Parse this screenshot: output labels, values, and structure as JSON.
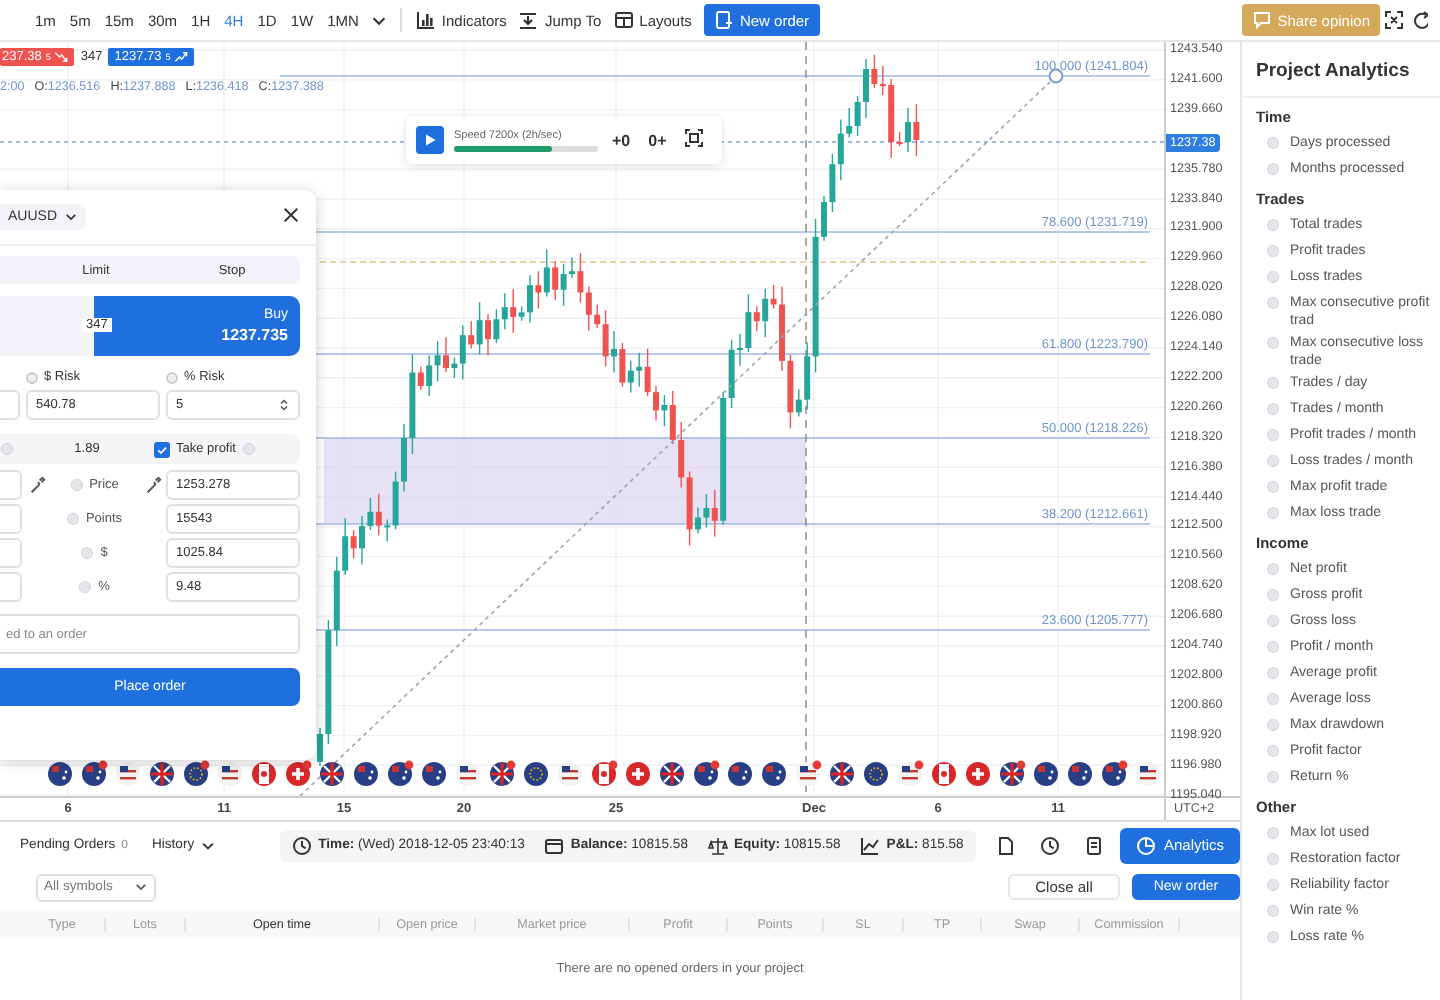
{
  "toolbar": {
    "timeframes": [
      {
        "label": "1m",
        "selected": false
      },
      {
        "label": "5m",
        "selected": false
      },
      {
        "label": "15m",
        "selected": false
      },
      {
        "label": "30m",
        "selected": false
      },
      {
        "label": "1H",
        "selected": false
      },
      {
        "label": "4H",
        "selected": true
      },
      {
        "label": "1D",
        "selected": false
      },
      {
        "label": "1W",
        "selected": false
      },
      {
        "label": "1MN",
        "selected": false
      }
    ],
    "tools": [
      {
        "label": "Indicators",
        "kind": "indicators"
      },
      {
        "label": "Jump To",
        "kind": "jump"
      },
      {
        "label": "Layouts",
        "kind": "layouts"
      },
      {
        "label": "New order",
        "kind": "primary"
      }
    ],
    "share_button": "Share opinion"
  },
  "chart": {
    "sell_price": "237.38$^{5}$",
    "spread": "347",
    "buy_price": "1237.73$^{5}$",
    "ohlc_time": "2:00",
    "ohlc": [
      {
        "label": "O:",
        "value": "1236.516"
      },
      {
        "label": "H:",
        "value": "1237.888"
      },
      {
        "label": "L:",
        "value": "1236.418"
      },
      {
        "label": "C:",
        "value": "1237.388"
      }
    ],
    "fib_levels": [
      "100.000 (1241.804)",
      "78.600 (1231.719)",
      "61.800 (1223.790)",
      "50.000 (1218.226)",
      "38.200 (1212.661)",
      "23.600 (1205.777)"
    ],
    "price_ticks": [
      "1243.540",
      "1241.600",
      "1239.660",
      "1235.780",
      "1233.840",
      "1231.900",
      "1229.960",
      "1228.020",
      "1226.080",
      "1224.140",
      "1222.200",
      "1220.260",
      "1218.320",
      "1216.380",
      "1214.440",
      "1212.500",
      "1210.560",
      "1208.620",
      "1206.680",
      "1204.740",
      "1202.800",
      "1200.860",
      "1198.920",
      "1196.980",
      "1195.040"
    ],
    "current_price": "1237.38",
    "date_ticks": [
      "6",
      "11",
      "15",
      "20",
      "25",
      "Dec",
      "6",
      "11"
    ],
    "timezone": "UTC+2"
  },
  "replay": {
    "speed_label": "Speed 7200x (2h/sec)",
    "level": 0.68,
    "step_back": "+0",
    "step_forward": "0+"
  },
  "order_panel": {
    "symbol": "AUUSD",
    "tabs": [
      {
        "label": "Limit",
        "selected": false
      },
      {
        "label": "Stop",
        "selected": false
      }
    ],
    "spread": "347",
    "buy_label": "Buy",
    "buy_price": "1237.735",
    "risk": [
      {
        "label": "$ Risk",
        "value": "540.78",
        "selected": false
      },
      {
        "label": "% Risk",
        "value": "5",
        "selected": false
      }
    ],
    "ratio": "1.89",
    "take_profit": {
      "label": "Take profit",
      "checked": true
    },
    "tp_rows": [
      {
        "label": "Price",
        "value": "1253.278"
      },
      {
        "label": "Points",
        "value": "15543"
      },
      {
        "label": "$",
        "value": "1025.84"
      },
      {
        "label": "%",
        "value": "9.48"
      }
    ],
    "comment_placeholder": "ed to an order",
    "place_button": "Place order"
  },
  "orders": {
    "tabs": [
      {
        "label": "Pending Orders",
        "count": "0",
        "selected": false
      },
      {
        "label": "History",
        "selected": false
      }
    ],
    "status": [
      {
        "kind": "time",
        "label": "Time:",
        "value": "(Wed) 2018-12-05 23:40:13"
      },
      {
        "kind": "balance",
        "label": "Balance:",
        "value": "10815.58"
      },
      {
        "kind": "equity",
        "label": "Equity:",
        "value": "10815.58"
      },
      {
        "kind": "pnl",
        "label": "P&L:",
        "value": "815.58"
      }
    ],
    "analytics_button": "Analytics",
    "symbol_filter": "All symbols",
    "close_all": "Close all",
    "new_order": "New order",
    "columns": [
      "Type",
      "Lots",
      "Open time",
      "Open price",
      "Market price",
      "Profit",
      "Points",
      "SL",
      "TP",
      "Swap",
      "Commission"
    ],
    "empty_message": "There are no opened orders in your project"
  },
  "sidebar": {
    "title": "Project Analytics",
    "sections": [
      {
        "title": "Time",
        "items": [
          "Days processed",
          "Months processed"
        ]
      },
      {
        "title": "Trades",
        "items": [
          "Total trades",
          "Profit trades",
          "Loss trades",
          "Max consecutive profit trad",
          "Max consecutive loss trade",
          "Trades / day",
          "Trades / month",
          "Profit trades / month",
          "Loss trades / month",
          "Max profit trade",
          "Max loss trade"
        ]
      },
      {
        "title": "Income",
        "items": [
          "Net profit",
          "Gross profit",
          "Gross loss",
          "Profit / month",
          "Average profit",
          "Average loss",
          "Max drawdown",
          "Profit factor",
          "Return %"
        ]
      },
      {
        "title": "Other",
        "items": [
          "Max lot used",
          "Restoration factor",
          "Reliability factor",
          "Win rate %",
          "Loss rate %"
        ]
      }
    ]
  }
}
